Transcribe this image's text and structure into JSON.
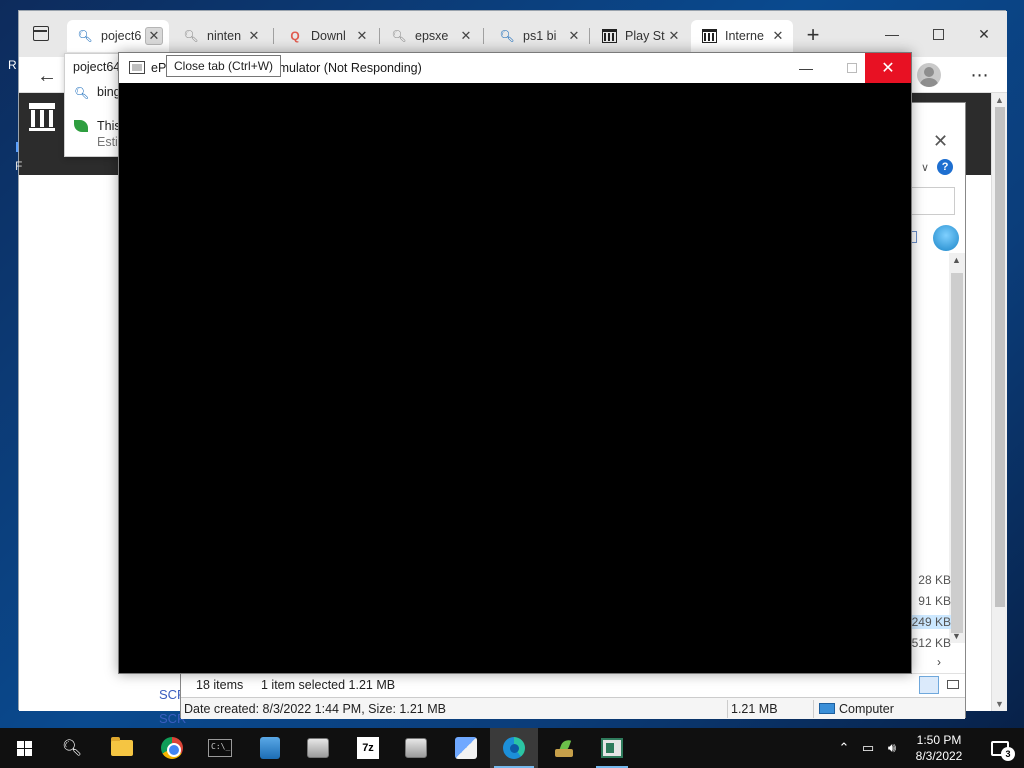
{
  "browser": {
    "tabs": [
      {
        "title": "poject6",
        "icon": "search-icon",
        "active": true
      },
      {
        "title": "ninten",
        "icon": "search-icon"
      },
      {
        "title": "Downl",
        "icon": "download-site-icon"
      },
      {
        "title": "epsxe",
        "icon": "search-icon"
      },
      {
        "title": "ps1 bi",
        "icon": "search-icon"
      },
      {
        "title": "Play St",
        "icon": "archive-icon"
      },
      {
        "title": "Interne",
        "icon": "archive-icon",
        "active": true
      }
    ],
    "new_tab_glyph": "+",
    "suggest": {
      "typed": "poject64",
      "search_row": "bing",
      "extension_row": "This",
      "extension_sub": "Estin"
    },
    "page": {
      "left_char_top": "R",
      "left_char_mid": "I",
      "left_char_low": "F",
      "links": [
        "SCR",
        "SCR"
      ]
    }
  },
  "explorer": {
    "sizes": [
      "28 KB",
      "91 KB",
      ",249 KB",
      "512 KB"
    ],
    "status": {
      "items": "18 items",
      "selected": "1 item selected  1.21 MB"
    },
    "details": {
      "created": "Date created: 8/3/2022 1:44 PM, Size: 1.21 MB",
      "size": "1.21 MB",
      "location": "Computer"
    }
  },
  "epsxe": {
    "title": "ePS",
    "title_tail": "mulator (Not Responding)"
  },
  "tooltip": "Close tab (Ctrl+W)",
  "taskbar": {
    "clock_time": "1:50 PM",
    "clock_date": "8/3/2022",
    "notification_count": "3",
    "sevenzip_label": "7z"
  }
}
